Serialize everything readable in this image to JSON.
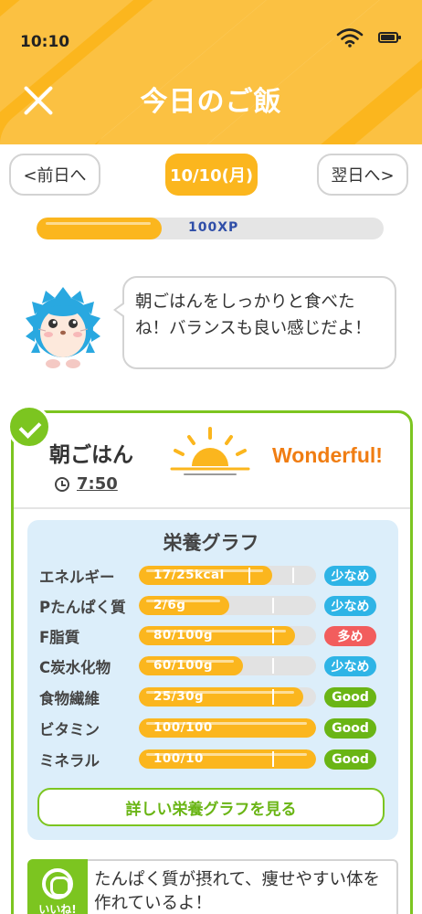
{
  "status_bar": {
    "time": "10:10"
  },
  "header": {
    "title": "今日のご飯"
  },
  "date_nav": {
    "prev_label": "<前日へ",
    "current_date": "10/10(月)",
    "next_label": "翌日へ>"
  },
  "xp": {
    "label": "100XP",
    "progress_percent": 36
  },
  "mascot_message": "朝ごはんをしっかりと食べたね！バランスも良い感じだよ！",
  "meal": {
    "name": "朝ごはん",
    "time": "7:50",
    "rating": "Wonderful!",
    "completed": true,
    "nutrition": {
      "title": "栄養グラフ",
      "rows": [
        {
          "label": "エネルギー",
          "value": "17/25kcal",
          "fill_percent": 75,
          "badge": "少なめ",
          "badge_color": "#2eb4e6"
        },
        {
          "label": "Pたんぱく質",
          "value": "2/6g",
          "fill_percent": 51,
          "badge": "少なめ",
          "badge_color": "#2eb4e6"
        },
        {
          "label": "F脂質",
          "value": "80/100g",
          "fill_percent": 88,
          "badge": "多め",
          "badge_color": "#f25d5d"
        },
        {
          "label": "C炭水化物",
          "value": "60/100g",
          "fill_percent": 59,
          "badge": "少なめ",
          "badge_color": "#2eb4e6"
        },
        {
          "label": "食物繊維",
          "value": "25/30g",
          "fill_percent": 93,
          "badge": "Good",
          "badge_color": "#6ab515"
        },
        {
          "label": "ビタミン",
          "value": "100/100",
          "fill_percent": 100,
          "badge": "Good",
          "badge_color": "#6ab515"
        },
        {
          "label": "ミネラル",
          "value": "100/10",
          "fill_percent": 100,
          "badge": "Good",
          "badge_color": "#6ab515"
        }
      ],
      "detail_button": "詳しい栄養グラフを見る"
    },
    "feedback": {
      "tag": "いいね!",
      "text": "たんぱく質が摂れて、痩せやすい体を作れているよ！"
    }
  },
  "colors": {
    "primary": "#fbb61e",
    "accent_green": "#7cc520",
    "rating_orange": "#f07d12",
    "low_blue": "#2eb4e6",
    "high_red": "#f25d5d"
  },
  "icons": [
    "wifi-icon",
    "battery-icon",
    "close-icon",
    "hedgehog-mascot",
    "check-icon",
    "clock-icon",
    "sunrise-icon",
    "good-circle-icon"
  ]
}
